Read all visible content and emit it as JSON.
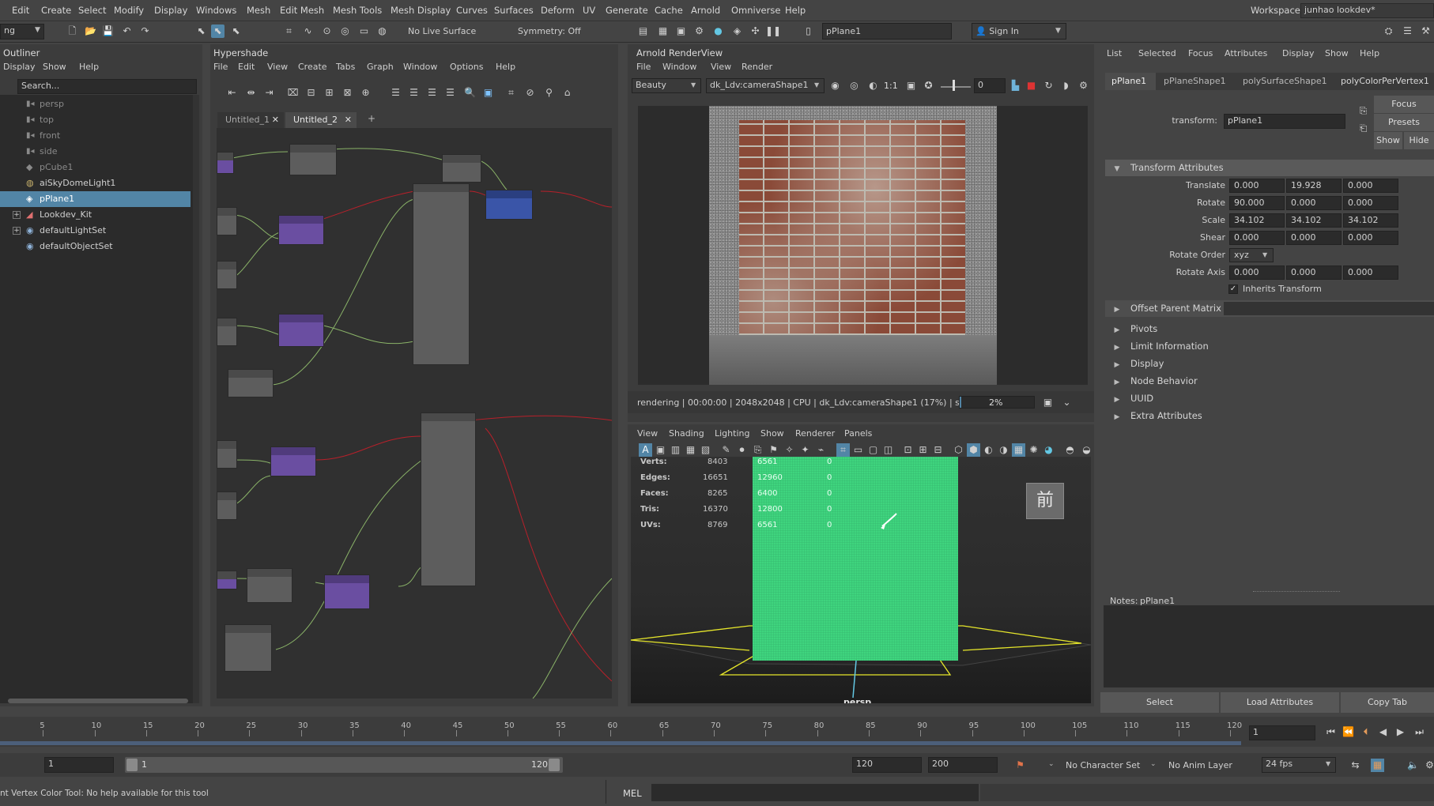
{
  "menubar": {
    "items": [
      "Edit",
      "Create",
      "Select",
      "Modify",
      "Display",
      "Windows",
      "Mesh",
      "Edit Mesh",
      "Mesh Tools",
      "Mesh Display",
      "Curves",
      "Surfaces",
      "Deform",
      "UV",
      "Generate",
      "Cache",
      "Arnold",
      "Omniverse",
      "Help"
    ],
    "workspace_label": "Workspace:",
    "workspace_value": "junhao lookdev*"
  },
  "toolbar": {
    "mode_value": "ng",
    "live_surface": "No Live Surface",
    "symmetry": "Symmetry: Off",
    "object_name": "pPlane1",
    "sign_in": "Sign In"
  },
  "outliner": {
    "title": "Outliner",
    "menus": [
      "Display",
      "Show",
      "Help"
    ],
    "search_placeholder": "Search...",
    "items": [
      {
        "label": "persp",
        "icon": "camera-icon",
        "dim": true
      },
      {
        "label": "top",
        "icon": "camera-icon",
        "dim": true
      },
      {
        "label": "front",
        "icon": "camera-icon",
        "dim": true
      },
      {
        "label": "side",
        "icon": "camera-icon",
        "dim": true
      },
      {
        "label": "pCube1",
        "icon": "mesh-icon",
        "dim": true
      },
      {
        "label": "aiSkyDomeLight1",
        "icon": "light-icon",
        "dim": false
      },
      {
        "label": "pPlane1",
        "icon": "mesh-icon",
        "dim": false,
        "selected": true
      },
      {
        "label": "Lookdev_Kit",
        "icon": "group-icon",
        "dim": false,
        "expand": true
      },
      {
        "label": "defaultLightSet",
        "icon": "set-icon",
        "dim": false,
        "expand": true
      },
      {
        "label": "defaultObjectSet",
        "icon": "set-icon",
        "dim": false
      }
    ]
  },
  "hypershade": {
    "title": "Hypershade",
    "menus": [
      "File",
      "Edit",
      "View",
      "Create",
      "Tabs",
      "Graph",
      "Window",
      "Options",
      "Help"
    ],
    "tabs": [
      "Untitled_1",
      "Untitled_2"
    ],
    "active_tab": "Untitled_2"
  },
  "renderview": {
    "title": "Arnold RenderView",
    "menus": [
      "File",
      "Window",
      "View",
      "Render"
    ],
    "aov": "Beauty",
    "camera": "dk_Ldv:cameraShape1",
    "ratio_label": "1:1",
    "exposure": "0",
    "status": "rendering | 00:00:00 | 2048x2048 | CPU | dk_Ldv:cameraShape1 (17%) | s...",
    "progress": "2%",
    "progress_fraction": 0.02
  },
  "viewport": {
    "menus": [
      "View",
      "Shading",
      "Lighting",
      "Show",
      "Renderer",
      "Panels"
    ],
    "hud": [
      {
        "label": "Verts:",
        "a": "8403",
        "b": "6561",
        "c": "0"
      },
      {
        "label": "Edges:",
        "a": "16651",
        "b": "12960",
        "c": "0"
      },
      {
        "label": "Faces:",
        "a": "8265",
        "b": "6400",
        "c": "0"
      },
      {
        "label": "Tris:",
        "a": "16370",
        "b": "12800",
        "c": "0"
      },
      {
        "label": "UVs:",
        "a": "8769",
        "b": "6561",
        "c": "0"
      }
    ],
    "camera_label": "persp",
    "view_cube_label": "前"
  },
  "attribute_editor": {
    "menus": [
      "List",
      "Selected",
      "Focus",
      "Attributes",
      "Display",
      "Show",
      "Help"
    ],
    "tabs": [
      "pPlane1",
      "pPlaneShape1",
      "polySurfaceShape1",
      "polyColorPerVertex1"
    ],
    "transform_label": "transform:",
    "transform_value": "pPlane1",
    "focus_btn": "Focus",
    "presets_btn": "Presets",
    "show_btn": "Show",
    "hide_btn": "Hide",
    "section_transform": "Transform Attributes",
    "translate": {
      "label": "Translate",
      "x": "0.000",
      "y": "19.928",
      "z": "0.000"
    },
    "rotate": {
      "label": "Rotate",
      "x": "90.000",
      "y": "0.000",
      "z": "0.000"
    },
    "scale": {
      "label": "Scale",
      "x": "34.102",
      "y": "34.102",
      "z": "34.102"
    },
    "shear": {
      "label": "Shear",
      "x": "0.000",
      "y": "0.000",
      "z": "0.000"
    },
    "rotate_order": {
      "label": "Rotate Order",
      "value": "xyz"
    },
    "rotate_axis": {
      "label": "Rotate Axis",
      "x": "0.000",
      "y": "0.000",
      "z": "0.000"
    },
    "inherits": "Inherits Transform",
    "offset_parent": "Offset Parent Matrix",
    "sections": [
      "Pivots",
      "Limit Information",
      "Display",
      "Node Behavior",
      "UUID",
      "Extra Attributes"
    ],
    "notes_label": "Notes:",
    "notes_value": "pPlane1",
    "bottom_buttons": [
      "Select",
      "Load Attributes",
      "Copy Tab"
    ]
  },
  "timeline": {
    "ticks": [
      "5",
      "10",
      "15",
      "20",
      "25",
      "30",
      "35",
      "40",
      "45",
      "50",
      "55",
      "60",
      "65",
      "70",
      "75",
      "80",
      "85",
      "90",
      "95",
      "100",
      "105",
      "110",
      "115",
      "120"
    ],
    "current_frame": "1"
  },
  "range": {
    "start": "1",
    "range_start": "1",
    "range_end": "120",
    "end": "120",
    "max": "200",
    "character_set": "No Character Set",
    "anim_layer": "No Anim Layer",
    "fps": "24 fps"
  },
  "statusline": {
    "help": "nt Vertex Color Tool: No help available for this tool",
    "lang": "MEL"
  },
  "colors": {
    "selection": "#5285a6",
    "viewport_mesh": "#3fd47e",
    "yellow_wire": "#e6e62a",
    "purple_node": "#6a4ea1"
  }
}
